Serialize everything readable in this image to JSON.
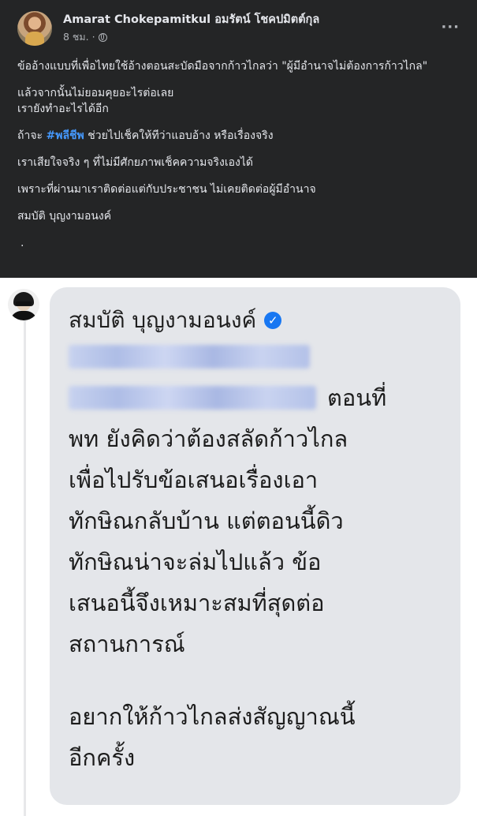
{
  "post": {
    "author": "Amarat Chokepamitkul อมรัตน์ โชคปมิตต์กุล",
    "time": "8 ชม. ·",
    "privacy_icon": "globe-icon",
    "more_icon": "more-options-icon",
    "paragraph1": "ข้ออ้างแบบที่เพื่อไทยใช้อ้างตอนสะบัดมือจากก้าวไกลว่า \"ผู้มีอำนาจไม่ต้องการก้าวไกล\"",
    "paragraph2_line1": "แล้วจากนั้นไม่ยอมคุยอะไรต่อเลย",
    "paragraph2_line2": "เรายังทำอะไรได้อีก",
    "paragraph3_before": "ถ้าจะ ",
    "hashtag": "#พลีชีพ",
    "paragraph3_after": " ช่วยไปเช็คให้ทีว่าแอบอ้าง หรือเรื่องจริง",
    "paragraph4": "เราเสียใจจริง ๆ ที่ไม่มีศักยภาพเช็คความจริงเองได้",
    "paragraph5": "เพราะที่ผ่านมาเราติดต่อแต่กับประชาชน ไม่เคยติดต่อผู้มีอำนาจ",
    "signature": "สมบัติ บุญงามอนงค์",
    "trailing_dot": "."
  },
  "chat": {
    "sender_name": "สมบัติ บุญงามอนงค์",
    "verified_icon": "verified-badge-icon",
    "verified_glyph": "✓",
    "text_after_blur": "ตอนที่",
    "lines": [
      "พท ยังคิดว่าต้องสลัดก้าวไกล",
      "เพื่อไปรับข้อเสนอเรื่องเอา",
      "ทักษิณกลับบ้าน แต่ตอนนี้ดิว",
      "ทักษิณน่าจะล่มไปแล้ว ข้อ",
      "เสนอนี้จึงเหมาะสมที่สุดต่อ",
      "สถานการณ์"
    ],
    "closing_lines": [
      "อยากให้ก้าวไกลส่งสัญญาณนี้",
      "อีกครั้ง"
    ]
  }
}
